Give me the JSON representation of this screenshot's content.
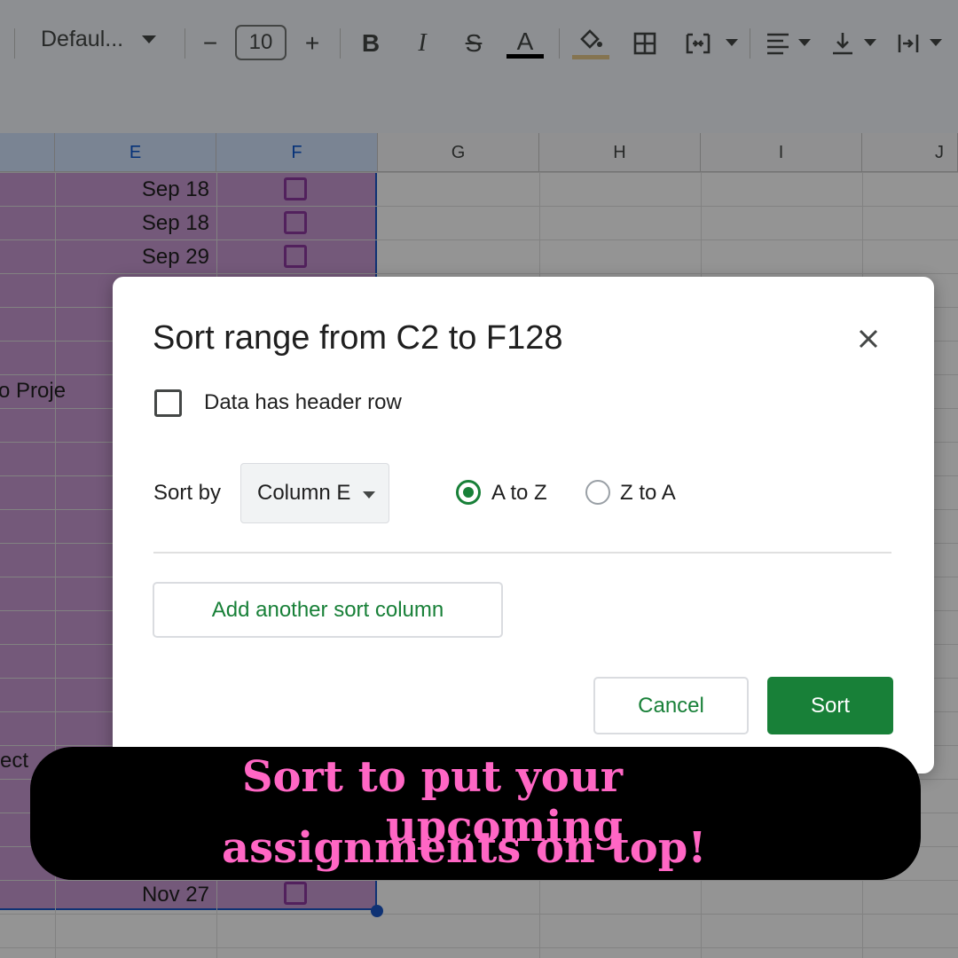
{
  "toolbar": {
    "font_family": "Defaul...",
    "font_size": "10",
    "minus_glyph": "−",
    "plus_glyph": "+",
    "bold_glyph": "B",
    "italic_glyph": "I",
    "strike_glyph": "S",
    "text_color_glyph": "A",
    "text_color": "#000000",
    "fill_color": "#e6c98a"
  },
  "grid": {
    "columns": [
      "E",
      "F",
      "G",
      "H",
      "I",
      "J"
    ],
    "selected_columns": [
      "E",
      "F"
    ],
    "rows": [
      {
        "date": "Sep 18",
        "checked": false
      },
      {
        "date": "Sep 18",
        "checked": false
      },
      {
        "date": "Sep 29",
        "checked": false
      }
    ],
    "partial_texts": [
      "o Proje",
      "ect"
    ],
    "last_row_date": "Nov 27",
    "selection_color": "#c99ad2"
  },
  "dialog": {
    "title": "Sort range from C2 to F128",
    "close_icon": "close-icon",
    "header_row_label": "Data has header row",
    "header_row_checked": false,
    "sort_by_label": "Sort by",
    "sort_column": "Column E",
    "order_options": [
      "A to Z",
      "Z to A"
    ],
    "order_selected": "A to Z",
    "add_column_label": "Add another sort column",
    "cancel_label": "Cancel",
    "sort_label": "Sort",
    "accent_color": "#188038"
  },
  "caption": {
    "line1": "Sort to put your upcoming",
    "line2": "assignments on top!",
    "color": "#ff66c4"
  }
}
